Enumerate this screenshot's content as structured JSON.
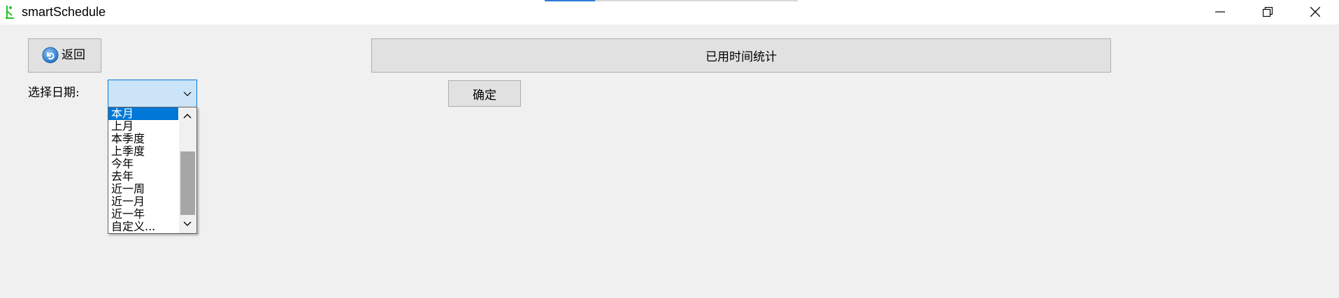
{
  "window": {
    "title": "smartSchedule",
    "controls": {
      "minimize": "minimize-icon",
      "restore": "restore-icon",
      "close": "close-icon"
    }
  },
  "toolbar": {
    "back_label": "返回",
    "header_title": "已用时间统计"
  },
  "form": {
    "date_label": "选择日期:",
    "confirm_label": "确定",
    "date_select": {
      "selected": "",
      "options": [
        "本月",
        "上月",
        "本季度",
        "上季度",
        "今年",
        "去年",
        "近一周",
        "近一月",
        "近一年",
        "自定义..."
      ],
      "highlighted": "本月"
    }
  },
  "colors": {
    "accent": "#0078d7",
    "combo_bg": "#cce4f7",
    "button_bg": "#e1e1e1",
    "window_bg": "#f0f0f0",
    "app_icon": "#22c522"
  }
}
